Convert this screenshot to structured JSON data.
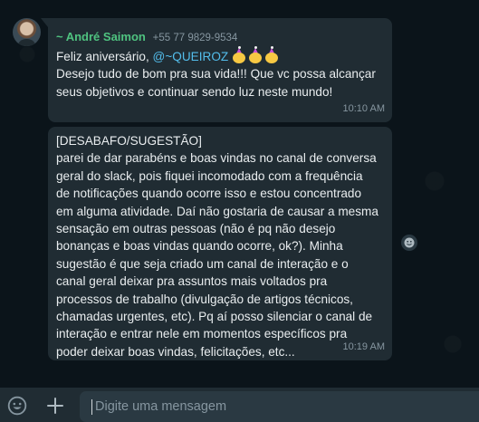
{
  "messages": [
    {
      "sender_name": "~ André Saimon",
      "sender_phone": "+55 77 9829-9534",
      "text_prefix": "Feliz aniversário, ",
      "mention": "@~QUEIROZ",
      "emojis": [
        "party-face-emoji",
        "party-face-emoji",
        "party-face-emoji"
      ],
      "text_rest": "Desejo tudo de bom pra sua vida!!! Que vc possa alcançar\nseus objetivos e continuar sendo luz neste mundo!",
      "time": "10:10 AM"
    },
    {
      "text": "[DESABAFO/SUGESTÃO]\nparei de dar parabéns e boas vindas no canal de conversa\ngeral do slack, pois fiquei incomodado com a frequência\nde notificações quando ocorre isso e estou concentrado\nem alguma atividade. Daí não gostaria de causar a mesma\nsensação em outras pessoas (não é pq não desejo\nbonanças e boas vindas quando ocorre, ok?). Minha\nsugestão é que seja criado um canal de interação e o\ncanal geral deixar pra assuntos mais voltados pra\nprocessos de trabalho (divulgação de artigos técnicos,\nchamadas urgentes, etc). Pq aí posso silenciar o canal de\ninteração e entrar nele em momentos específicos pra\npoder deixar boas vindas, felicitações, etc...",
      "time": "10:19 AM"
    }
  ],
  "composer": {
    "placeholder": "Digite uma mensagem"
  },
  "icons": {
    "emoji_button": "smiley-icon",
    "attach_button": "plus-icon",
    "reaction_button": "smiley-icon"
  },
  "colors": {
    "background": "#0b141a",
    "bubble": "#202c33",
    "sender_name": "#4fc380",
    "mention": "#53bdeb",
    "meta_text": "#8696a0"
  }
}
